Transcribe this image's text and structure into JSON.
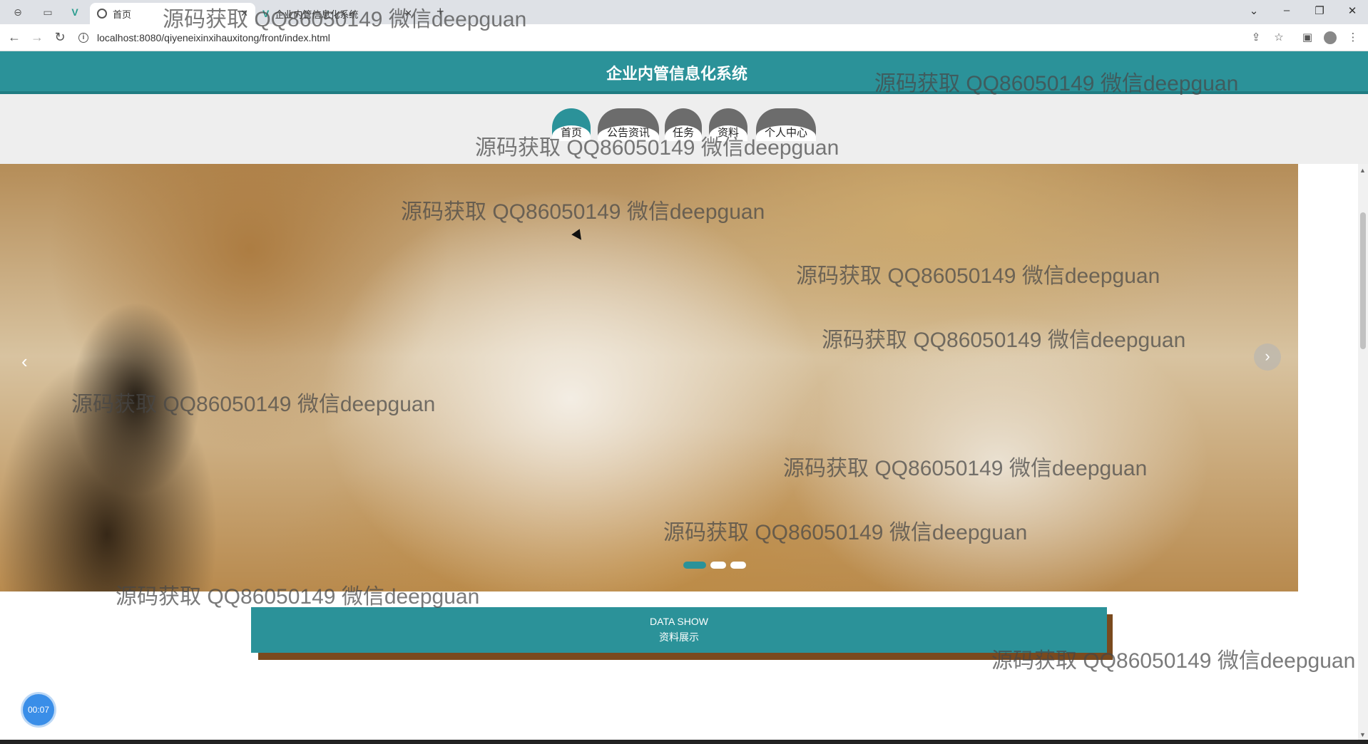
{
  "browser": {
    "tabs": [
      {
        "title": "首页",
        "active": true
      },
      {
        "title": "企业内管信息化系统",
        "active": false
      }
    ],
    "url": "localhost:8080/qiyeneixinxihauxitong/front/index.html"
  },
  "header": {
    "title": "企业内管信息化系统"
  },
  "nav": [
    {
      "label": "首页",
      "active": true
    },
    {
      "label": "公告资讯",
      "active": false
    },
    {
      "label": "任务",
      "active": false
    },
    {
      "label": "资料",
      "active": false
    },
    {
      "label": "个人中心",
      "active": false
    }
  ],
  "banner": {
    "slide_count": 3,
    "active_slide": 1
  },
  "section": {
    "title_en": "DATA SHOW",
    "title_zh": "资料展示"
  },
  "timer": {
    "text": "00:07"
  },
  "watermark": "源码获取 QQ86050149 微信deepguan"
}
